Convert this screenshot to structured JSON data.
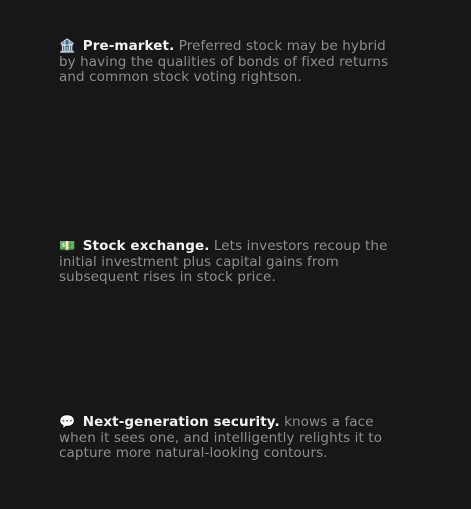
{
  "features": [
    {
      "icon": "🏦",
      "icon_name": "bank-icon",
      "title": "Pre-market.",
      "text": "Preferred stock may be hybrid by having the qualities of bonds of fixed returns and common stock voting rightson."
    },
    {
      "icon": "💵",
      "icon_name": "banknote-icon",
      "title": "Stock exchange.",
      "text": "Lets investors recoup the initial investment plus capital gains from subsequent rises in stock price."
    },
    {
      "icon": "💬",
      "icon_name": "speech-bubble-icon",
      "title": "Next-generation security.",
      "text": "knows a face when it sees one, and intelligently relights it to capture more natural-looking contours."
    }
  ],
  "colors": {
    "background": "#171717",
    "title": "#f1f1f1",
    "body": "#8d8d8d"
  }
}
